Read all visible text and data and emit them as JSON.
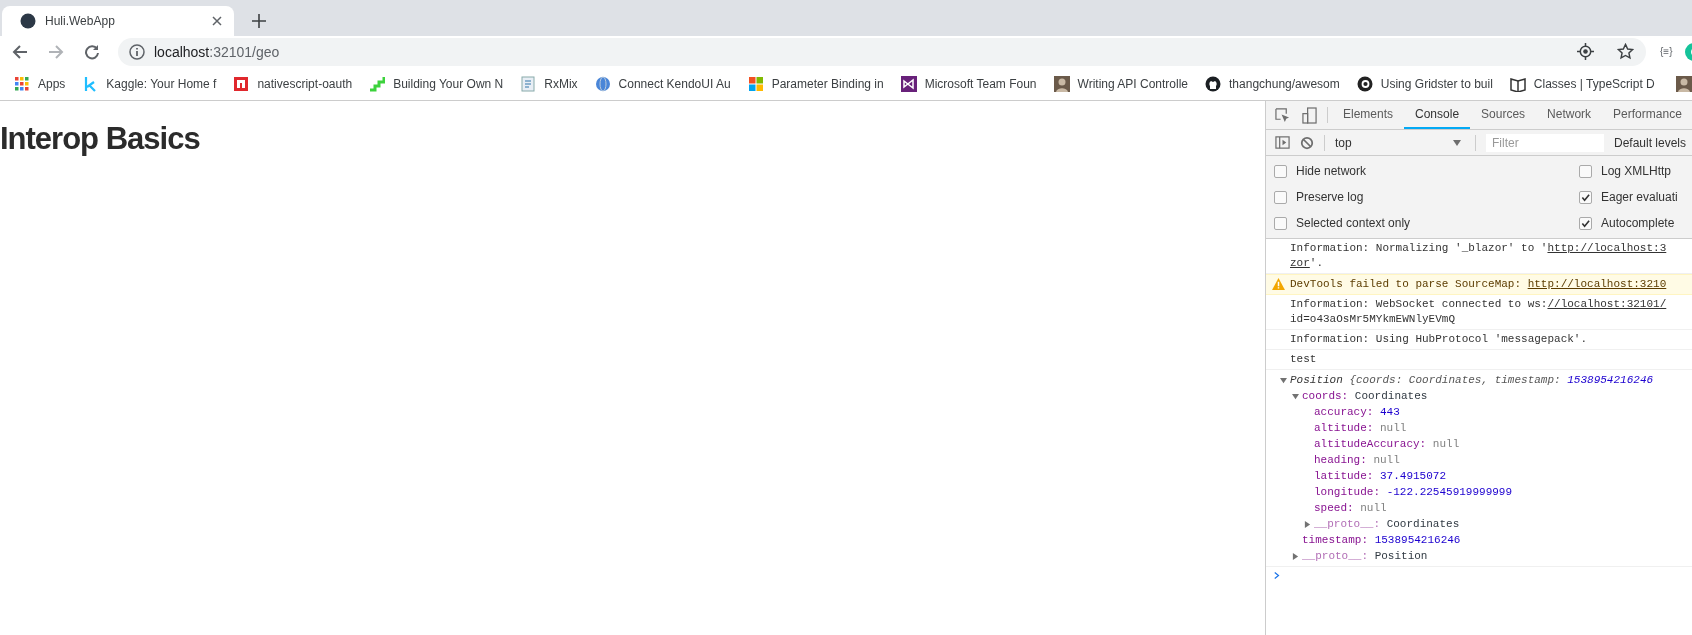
{
  "browser_tab": {
    "title": "Huli.WebApp"
  },
  "address_bar": {
    "host": "localhost",
    "path": ":32101/geo"
  },
  "extension_label": "{≡}",
  "bookmarks": [
    {
      "label": "Apps"
    },
    {
      "label": "Kaggle: Your Home f"
    },
    {
      "label": "nativescript-oauth"
    },
    {
      "label": "Building Your Own N"
    },
    {
      "label": "RxMix"
    },
    {
      "label": "Connect KendoUI Au"
    },
    {
      "label": "Parameter Binding in"
    },
    {
      "label": "Microsoft Team Foun"
    },
    {
      "label": "Writing API Controlle"
    },
    {
      "label": "thangchung/awesom"
    },
    {
      "label": "Using Gridster to buil"
    },
    {
      "label": "Classes | TypeScript D"
    }
  ],
  "page": {
    "heading": "Interop Basics"
  },
  "devtools": {
    "tabs": [
      {
        "label": "Elements",
        "selected": false
      },
      {
        "label": "Console",
        "selected": true
      },
      {
        "label": "Sources",
        "selected": false
      },
      {
        "label": "Network",
        "selected": false
      },
      {
        "label": "Performance",
        "selected": false
      }
    ],
    "context": "top",
    "filter_placeholder": "Filter",
    "levels": "Default levels",
    "settings": [
      {
        "label": "Hide network",
        "checked": false
      },
      {
        "label": "Log XMLHttp",
        "checked": false
      },
      {
        "label": "Preserve log",
        "checked": false
      },
      {
        "label": "Eager evaluati",
        "checked": true
      },
      {
        "label": "Selected context only",
        "checked": false
      },
      {
        "label": "Autocomplete",
        "checked": true
      }
    ],
    "messages": [
      {
        "kind": "info",
        "lines": [
          [
            {
              "text": "Information: Normalizing '_blazor' to '",
              "kind": "text"
            },
            {
              "text": "http://localhost:3",
              "kind": "link"
            }
          ],
          [
            {
              "text": "zor",
              "kind": "link"
            },
            {
              "text": "'.",
              "kind": "text"
            }
          ]
        ]
      },
      {
        "kind": "warning",
        "lines": [
          [
            {
              "text": "DevTools failed to parse SourceMap: ",
              "kind": "text"
            },
            {
              "text": "http://localhost:3210",
              "kind": "link"
            }
          ]
        ]
      },
      {
        "kind": "info",
        "lines": [
          [
            {
              "text": "Information: WebSocket connected to ws:",
              "kind": "text"
            },
            {
              "text": "//localhost:32101/",
              "kind": "link"
            }
          ],
          [
            {
              "text": "id=o43aOsMr5MYkmEWNlyEVmQ",
              "kind": "text"
            }
          ]
        ]
      },
      {
        "kind": "info",
        "lines": [
          [
            {
              "text": "Information: Using HubProtocol 'messagepack'.",
              "kind": "text"
            }
          ]
        ]
      },
      {
        "kind": "info",
        "lines": [
          [
            {
              "text": "test",
              "kind": "text"
            }
          ]
        ]
      },
      {
        "kind": "object",
        "label": "Position",
        "preview": "{coords: Coordinates, timestamp: ",
        "preview_value": "1538954216246",
        "expanded": true,
        "children": [
          {
            "key": "coords:",
            "value": "Coordinates",
            "kind": "object",
            "dimmed": false,
            "expanded": true,
            "children": [
              {
                "key": "accuracy:",
                "value": "443",
                "kind": "number",
                "dimmed": false
              },
              {
                "key": "altitude:",
                "value": "null",
                "kind": "null",
                "dimmed": false
              },
              {
                "key": "altitudeAccuracy:",
                "value": "null",
                "kind": "null",
                "dimmed": false
              },
              {
                "key": "heading:",
                "value": "null",
                "kind": "null",
                "dimmed": false
              },
              {
                "key": "latitude:",
                "value": "37.4915072",
                "kind": "number",
                "dimmed": false
              },
              {
                "key": "longitude:",
                "value": "-122.22545919999999",
                "kind": "number",
                "dimmed": false
              },
              {
                "key": "speed:",
                "value": "null",
                "kind": "null",
                "dimmed": false
              },
              {
                "key": "__proto__:",
                "value": "Coordinates",
                "kind": "object",
                "dimmed": true,
                "expanded": false
              }
            ]
          },
          {
            "key": "timestamp:",
            "value": "1538954216246",
            "kind": "number",
            "dimmed": false
          },
          {
            "key": "__proto__:",
            "value": "Position",
            "kind": "object",
            "dimmed": true,
            "expanded": false
          }
        ]
      }
    ]
  }
}
